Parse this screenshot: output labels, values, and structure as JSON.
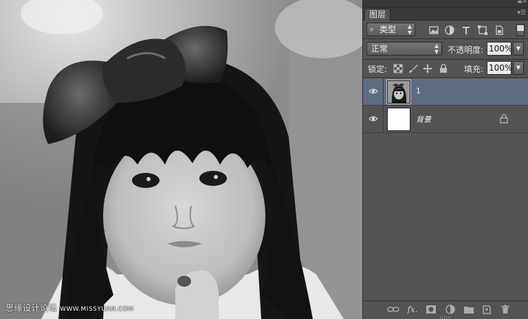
{
  "panel": {
    "tab_label": "图层",
    "filter": {
      "selected": "类型",
      "icons": [
        "image-filter-icon",
        "adjustment-filter-icon",
        "type-filter-icon",
        "shape-filter-icon",
        "smart-object-filter-icon"
      ]
    },
    "blend_mode": {
      "selected": "正常"
    },
    "opacity": {
      "label": "不透明度:",
      "value": "100%"
    },
    "lock": {
      "label": "锁定:",
      "icons": [
        "lock-transparent-icon",
        "lock-brush-icon",
        "lock-move-icon",
        "lock-all-icon"
      ]
    },
    "fill": {
      "label": "填充:",
      "value": "100%"
    },
    "layers": [
      {
        "name": "1",
        "visible": true,
        "selected": true,
        "locked": false,
        "thumbnail": "photo"
      },
      {
        "name": "背景",
        "visible": true,
        "selected": false,
        "locked": true,
        "thumbnail": "white"
      }
    ],
    "bottom_icons": [
      "link-layers-icon",
      "fx-icon",
      "add-mask-icon",
      "adjustment-layer-icon",
      "new-group-icon",
      "new-layer-icon",
      "delete-layer-icon"
    ],
    "fx_label": "fx."
  },
  "canvas": {
    "watermark_text": "思缘设计论坛",
    "watermark_url": "WWW.MISSYUAN.COM"
  },
  "colors": {
    "panel_bg": "#535353",
    "selected_layer": "#5d6b80",
    "field_bg": "#e9e9e9"
  }
}
